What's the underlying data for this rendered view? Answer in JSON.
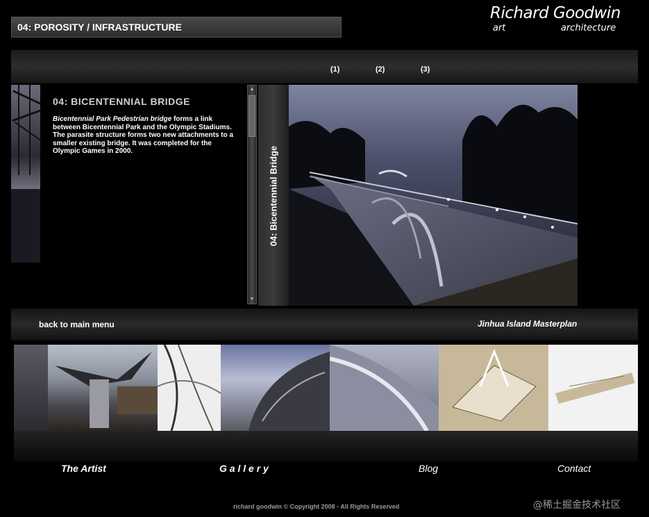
{
  "header": {
    "section_title": "04: POROSITY / INFRASTRUCTURE",
    "brand_name": "Richard Goodwin",
    "brand_art": "art",
    "brand_architecture": "architecture"
  },
  "pagination": [
    "(1)",
    "(2)",
    "(3)"
  ],
  "article": {
    "title": "04: BICENTENNIAL BRIDGE",
    "body_lead": "Bicentennial Park Pedestrian bridge",
    "body_text": " forms a link between Bicentennial Park and the Olympic Stadiums. The parasite structure forms  two new attachments to a smaller existing bridge. It was completed for the Olympic Games in 2000."
  },
  "side_tab_label": "04: Bicentennial Bridge",
  "nav_bar": {
    "back": "back to main menu",
    "next": "Jinhua Island Masterplan"
  },
  "main_nav": {
    "artist": "The Artist",
    "gallery": "G a l l e r y",
    "blog": "Blog",
    "contact": "Contact"
  },
  "footer": "richard goodwin  © Copyright  2008 - All Rights Reserved",
  "watermark": "@稀土掘金技术社区"
}
